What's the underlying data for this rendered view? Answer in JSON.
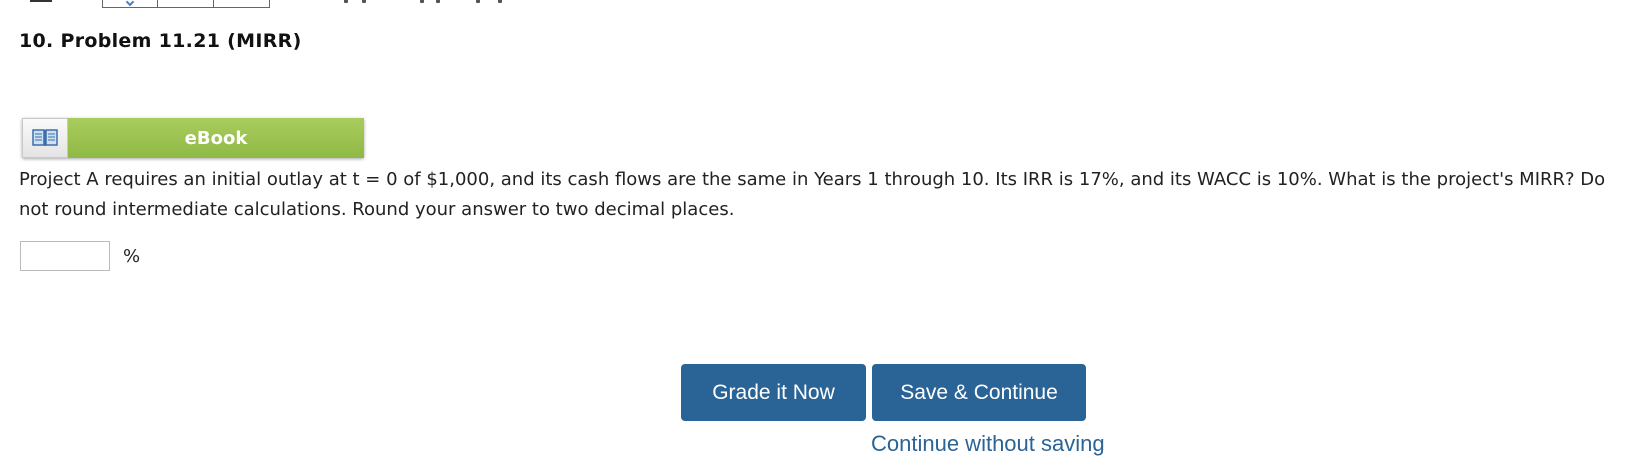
{
  "problem": {
    "title": "10.  Problem 11.21 (MIRR)"
  },
  "ebook": {
    "label": "eBook",
    "icon": "book-icon"
  },
  "question": {
    "text": "Project A requires an initial outlay at t = 0 of $1,000, and its cash flows are the same in Years 1 through 10. Its IRR is 17%, and its WACC is 10%. What is the project's MIRR? Do not round intermediate calculations. Round your answer to two decimal places.",
    "answer_value": "",
    "answer_unit": "%"
  },
  "actions": {
    "grade_label": "Grade it Now",
    "save_label": "Save & Continue",
    "continue_label": "Continue without saving"
  },
  "colors": {
    "button_bg": "#2a6496",
    "ebook_green": "#9bc24f",
    "link": "#2a6496"
  }
}
